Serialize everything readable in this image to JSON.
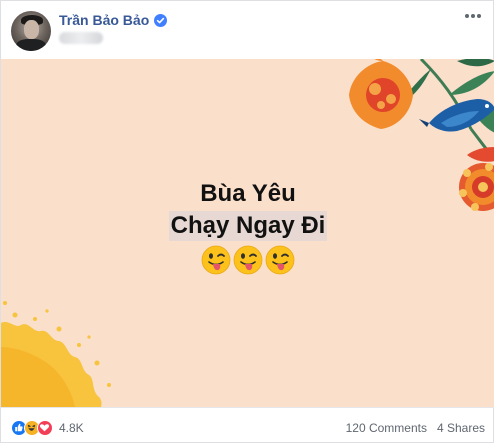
{
  "post": {
    "author": "Trần Bảo Bảo",
    "verified": true,
    "menu_icon": "more-horizontal-icon"
  },
  "content": {
    "line1": "Bùa Yêu",
    "line2": "Chạy Ngay Đi",
    "emojis": [
      "winking-tongue-face-emoji",
      "winking-tongue-face-emoji",
      "winking-tongue-face-emoji"
    ],
    "background_color": "#fadfcb",
    "highlight_color": "#e7d8d3"
  },
  "footer": {
    "reaction_icons": [
      "like-icon",
      "haha-icon",
      "love-icon"
    ],
    "reaction_count": "4.8K",
    "comments": "120 Comments",
    "shares": "4 Shares"
  },
  "colors": {
    "author_link": "#385898",
    "verified_badge": "#4080ff",
    "like": "#1877f2",
    "haha": "#f7b125",
    "love": "#f33e58",
    "muted_text": "#606770"
  }
}
